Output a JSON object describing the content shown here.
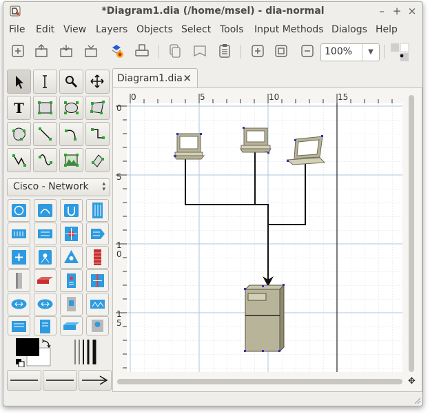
{
  "window": {
    "title": "*Diagram1.dia (/home/msel) - dia-normal",
    "minimize": "–",
    "maximize": "+",
    "close": "×"
  },
  "menu": [
    "File",
    "Edit",
    "View",
    "Layers",
    "Objects",
    "Select",
    "Tools",
    "Input Methods",
    "Dialogs",
    "Help"
  ],
  "toolbar": {
    "buttons": [
      "new-diagram-icon",
      "open-icon",
      "save-icon",
      "save-as-icon",
      "export-icon",
      "print-icon",
      "copy-icon",
      "paste-icon",
      "clipboard-icon",
      "zoom-in-icon",
      "best-fit-icon",
      "zoom-out-icon"
    ],
    "zoom_value": "100%"
  },
  "toolbox": {
    "tools": [
      "pointer-tool",
      "text-edit-tool",
      "magnify-tool",
      "scroll-tool",
      "text-tool",
      "box-tool",
      "ellipse-tool",
      "polygon-tool",
      "beziergon-tool",
      "line-tool",
      "arc-tool",
      "zigzag-tool",
      "polyline-tool",
      "bezier-tool",
      "image-tool",
      "outline-tool"
    ],
    "sheet": "Cisco - Network",
    "colors": {
      "foreground": "#000000",
      "background": "#ffffff"
    }
  },
  "tab": {
    "label": "Diagram1.dia",
    "close": "×"
  },
  "rulers": {
    "horizontal": [
      "0",
      "5",
      "10",
      "15"
    ],
    "vertical": [
      "0",
      "5",
      "1\n0",
      "1\n5"
    ]
  }
}
